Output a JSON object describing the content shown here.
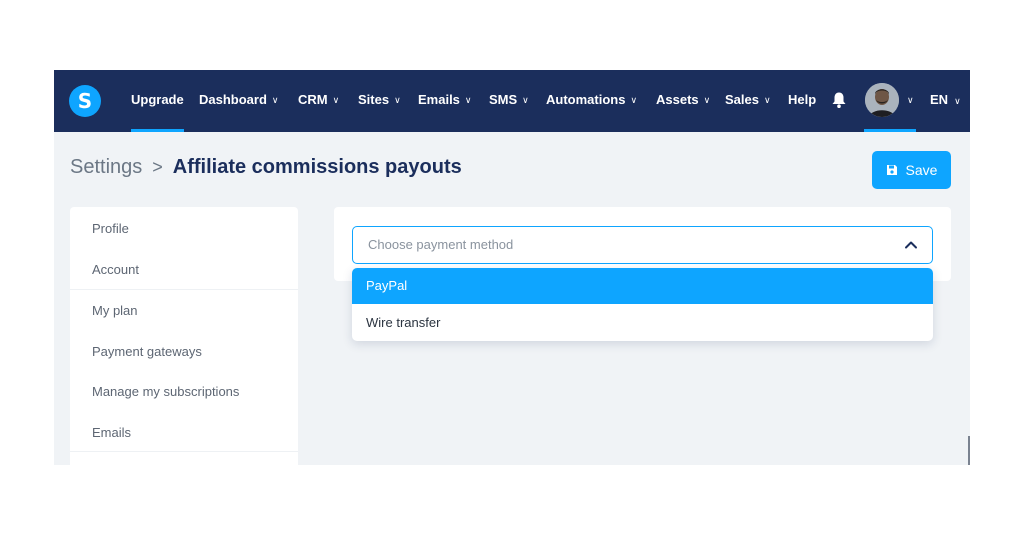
{
  "colors": {
    "nav_bg": "#1b2e5c",
    "accent": "#0ea5ff",
    "page_bg": "#f0f3f6"
  },
  "topbar": {
    "logo_letter": "S",
    "nav": [
      {
        "label": "Upgrade",
        "has_dropdown": false,
        "active": true
      },
      {
        "label": "Dashboard",
        "has_dropdown": true
      },
      {
        "label": "CRM",
        "has_dropdown": true
      },
      {
        "label": "Sites",
        "has_dropdown": true
      },
      {
        "label": "Emails",
        "has_dropdown": true
      },
      {
        "label": "SMS",
        "has_dropdown": true
      },
      {
        "label": "Automations",
        "has_dropdown": true
      },
      {
        "label": "Assets",
        "has_dropdown": true
      },
      {
        "label": "Sales",
        "has_dropdown": true
      },
      {
        "label": "Help",
        "has_dropdown": false
      }
    ],
    "bell_icon": "bell-icon",
    "language": "EN"
  },
  "breadcrumb": {
    "parent": "Settings",
    "separator": ">",
    "current": "Affiliate commissions payouts"
  },
  "toolbar": {
    "save_label": "Save",
    "save_icon": "floppy-disk-icon"
  },
  "sidebar": {
    "items": [
      {
        "label": "Profile"
      },
      {
        "label": "Account"
      },
      {
        "label": "My plan"
      },
      {
        "label": "Payment gateways"
      },
      {
        "label": "Manage my subscriptions"
      },
      {
        "label": "Emails"
      }
    ]
  },
  "payment_method": {
    "placeholder": "Choose payment method",
    "expanded": true,
    "options": [
      {
        "label": "PayPal",
        "highlighted": true
      },
      {
        "label": "Wire transfer",
        "highlighted": false
      }
    ]
  }
}
